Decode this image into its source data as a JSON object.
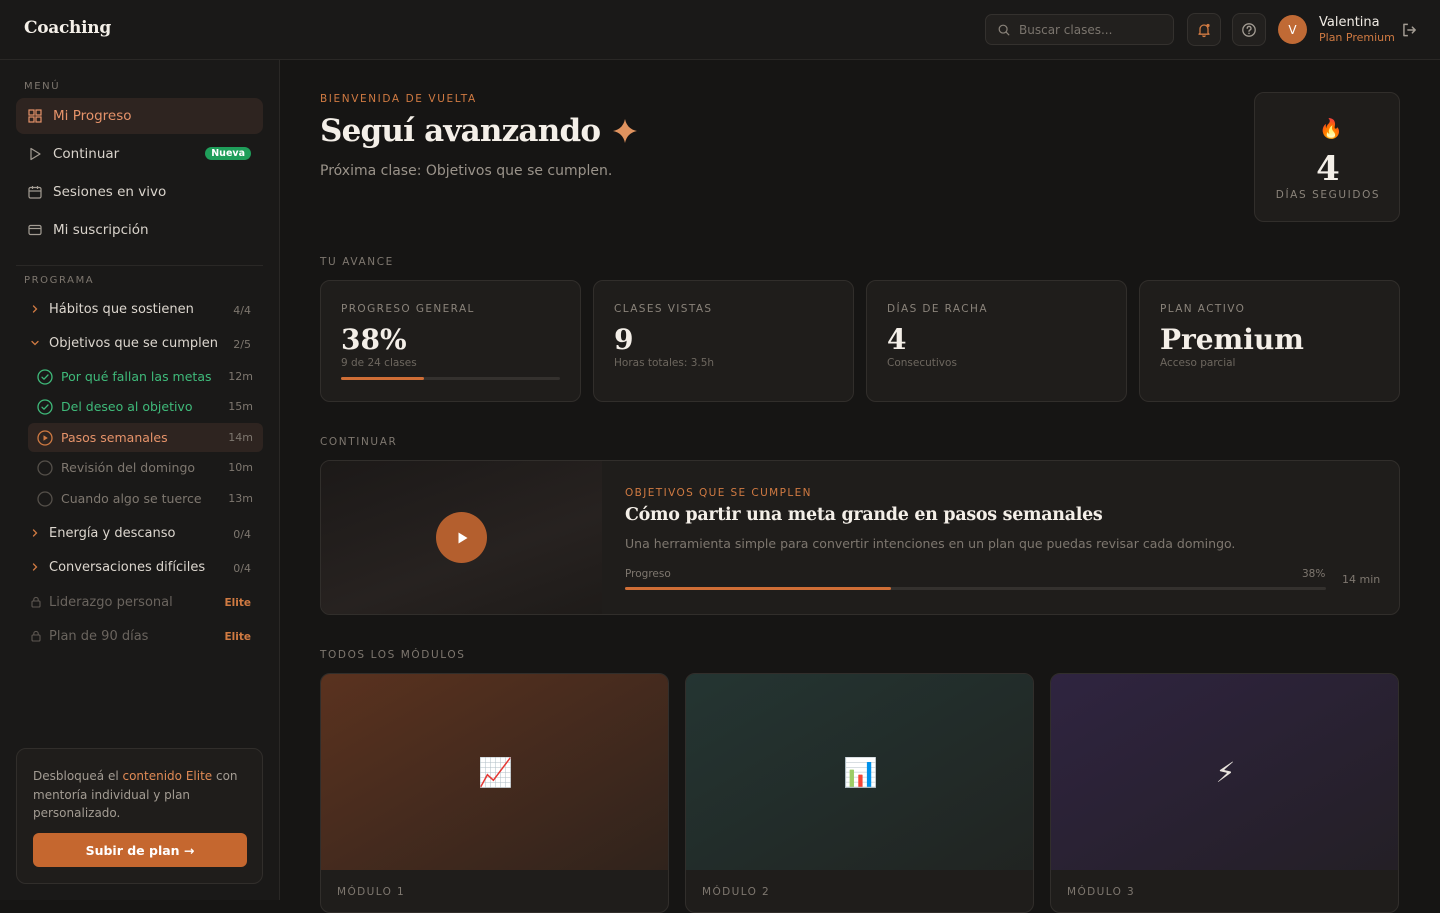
{
  "app": {
    "title": "Coaching"
  },
  "header": {
    "search_placeholder": "Buscar clases...",
    "user": {
      "initial": "V",
      "name": "Valentina",
      "plan": "Plan Premium"
    }
  },
  "sidebar": {
    "menu_label": "MENÚ",
    "nav": [
      {
        "label": "Mi Progreso",
        "icon": "grid-icon",
        "active": true
      },
      {
        "label": "Continuar",
        "icon": "play-outline-icon",
        "badge": "Nueva"
      },
      {
        "label": "Sesiones en vivo",
        "icon": "calendar-icon"
      },
      {
        "label": "Mi suscripción",
        "icon": "card-icon"
      }
    ],
    "program_label": "PROGRAMA",
    "modules": [
      {
        "label": "Hábitos que sostienen",
        "count": "4/4",
        "expanded": false
      },
      {
        "label": "Objetivos que se cumplen",
        "count": "2/5",
        "expanded": true,
        "lessons": [
          {
            "label": "Por qué fallan las metas",
            "duration": "12m",
            "state": "done"
          },
          {
            "label": "Del deseo al objetivo",
            "duration": "15m",
            "state": "done"
          },
          {
            "label": "Pasos semanales",
            "duration": "14m",
            "state": "current"
          },
          {
            "label": "Revisión del domingo",
            "duration": "10m",
            "state": "pending"
          },
          {
            "label": "Cuando algo se tuerce",
            "duration": "13m",
            "state": "pending"
          }
        ]
      },
      {
        "label": "Energía y descanso",
        "count": "0/4",
        "expanded": false
      },
      {
        "label": "Conversaciones difíciles",
        "count": "0/4",
        "expanded": false
      },
      {
        "label": "Liderazgo personal",
        "tag": "Elite",
        "locked": true
      },
      {
        "label": "Plan de 90 días",
        "tag": "Elite",
        "locked": true
      }
    ],
    "upsell": {
      "text_before": "Desbloqueá el ",
      "highlight": "contenido Elite",
      "text_after": " con mentoría individual y plan personalizado.",
      "button": "Subir de plan →"
    }
  },
  "hero": {
    "kicker": "BIENVENIDA DE VUELTA",
    "title": "Seguí avanzando",
    "subtitle": "Próxima clase: Objetivos que se cumplen.",
    "streak": {
      "value": "4",
      "label": "DÍAS SEGUIDOS"
    }
  },
  "progress": {
    "section_label": "TU AVANCE",
    "stats": [
      {
        "label": "PROGRESO GENERAL",
        "value": "38%",
        "sub": "9 de 24 clases",
        "bar": 0.38
      },
      {
        "label": "CLASES VISTAS",
        "value": "9",
        "sub": "Horas totales: 3.5h"
      },
      {
        "label": "DÍAS DE RACHA",
        "value": "4",
        "sub": "Consecutivos"
      },
      {
        "label": "PLAN ACTIVO",
        "value": "Premium",
        "sub": "Acceso parcial"
      }
    ]
  },
  "continue": {
    "section_label": "CONTINUAR",
    "kicker": "OBJETIVOS QUE SE CUMPLEN",
    "title": "Cómo partir una meta grande en pasos semanales",
    "description": "Una herramienta simple para convertir intenciones en un plan que puedas revisar cada domingo.",
    "progress_label": "Progreso",
    "progress_value": "38%",
    "progress": 0.38,
    "duration": "14 min"
  },
  "modules": {
    "section_label": "TODOS LOS MÓDULOS",
    "cards": [
      {
        "label": "MÓDULO 1",
        "emoji": "📈",
        "icon": "chart-up-icon",
        "color": "#5a321f"
      },
      {
        "label": "MÓDULO 2",
        "emoji": "📊",
        "icon": "bar-chart-icon",
        "color": "#243532"
      },
      {
        "label": "MÓDULO 3",
        "emoji": "⚡",
        "icon": "lightning-icon",
        "color": "#2f2440"
      }
    ]
  }
}
